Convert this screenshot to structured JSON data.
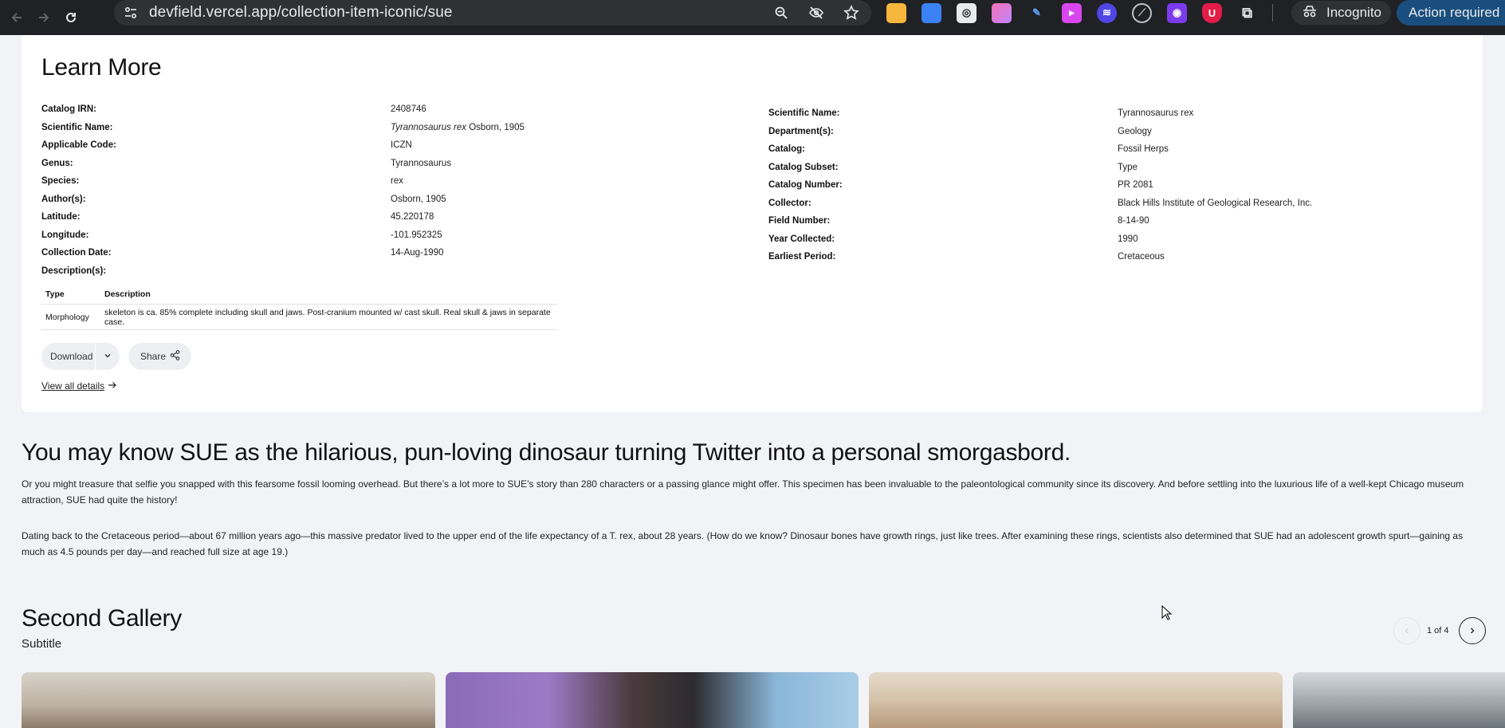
{
  "browser": {
    "url": "devfield.vercel.app/collection-item-iconic/sue",
    "incognito_label": "Incognito",
    "action_required_label": "Action required"
  },
  "learn_more": {
    "title": "Learn More",
    "left_fields": [
      {
        "label": "Catalog IRN:",
        "value": "2408746"
      },
      {
        "label": "Scientific Name:",
        "value_italic": "Tyrannosaurus rex",
        "value": " Osborn, 1905"
      },
      {
        "label": "Applicable Code:",
        "value": "ICZN"
      },
      {
        "label": "Genus:",
        "value": "Tyrannosaurus"
      },
      {
        "label": "Species:",
        "value": "rex"
      },
      {
        "label": "Author(s):",
        "value": "Osborn, 1905"
      },
      {
        "label": "Latitude:",
        "value": "45.220178"
      },
      {
        "label": "Longitude:",
        "value": "-101.952325"
      },
      {
        "label": "Collection Date:",
        "value": "14-Aug-1990"
      },
      {
        "label": "Description(s):",
        "value": ""
      }
    ],
    "right_fields": [
      {
        "label": "Scientific Name:",
        "value": "Tyrannosaurus rex"
      },
      {
        "label": "Department(s):",
        "value": "Geology"
      },
      {
        "label": "Catalog:",
        "value": "Fossil Herps"
      },
      {
        "label": "Catalog Subset:",
        "value": "Type"
      },
      {
        "label": "Catalog Number:",
        "value": "PR 2081"
      },
      {
        "label": "Collector:",
        "value": "Black Hills Institute of Geological Research, Inc."
      },
      {
        "label": "Field Number:",
        "value": "8-14-90"
      },
      {
        "label": "Year Collected:",
        "value": "1990"
      },
      {
        "label": "Earliest Period:",
        "value": "Cretaceous"
      }
    ],
    "description_table": {
      "headers": [
        "Type",
        "Description"
      ],
      "rows": [
        [
          "Morphology",
          "skeleton is ca. 85% complete including skull and jaws. Post-cranium mounted w/ cast skull. Real skull & jaws in separate case."
        ]
      ]
    },
    "download_label": "Download",
    "share_label": "Share",
    "view_all_label": "View all details"
  },
  "story": {
    "title": "You may know SUE as the hilarious, pun-loving dinosaur turning Twitter into a personal smorgasbord.",
    "paragraph1": "Or you might treasure that selfie you snapped with this fearsome fossil looming overhead. But there’s a lot more to SUE’s story than 280 characters or a passing glance might offer. This specimen has been invaluable to the paleontological community since its discovery. And before settling into the luxurious life of a well-kept Chicago museum attraction, SUE had quite the history!",
    "paragraph2": "Dating back to the Cretaceous period—about 67 million years ago—this massive predator lived to the upper end of the life expectancy of a T. rex, about 28 years. (How do we know? Dinosaur bones have growth rings, just like trees. After examining these rings, scientists also determined that SUE had an adolescent growth spurt—gaining as much as 4.5 pounds per day—and reached full size at age 19.)"
  },
  "gallery": {
    "title": "Second Gallery",
    "subtitle": "Subtitle",
    "pager_text": "1 of 4"
  },
  "colors": {
    "page_bg": "#f2f3f7",
    "card_bg": "#ffffff",
    "chrome_bg": "#202124",
    "action_required_bg": "#1a4e7e"
  }
}
